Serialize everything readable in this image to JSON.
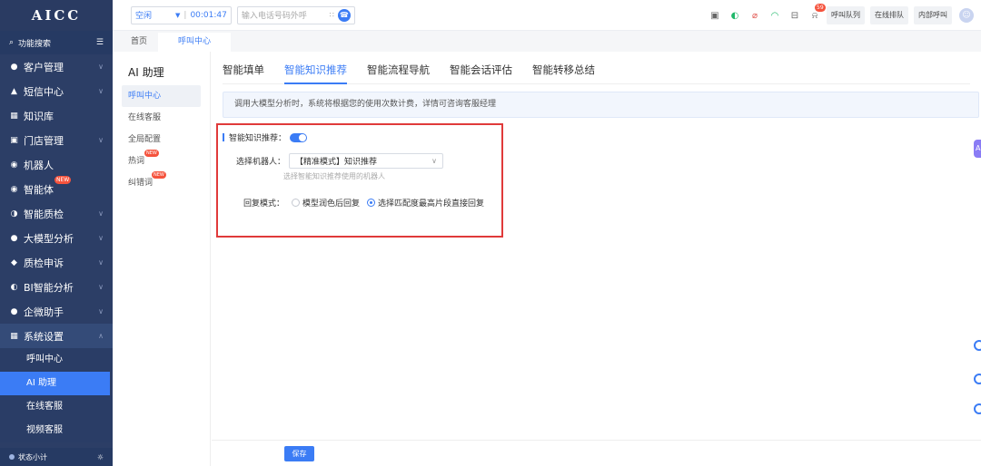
{
  "app": {
    "logo": "AICC"
  },
  "sidebar": {
    "search_label": "功能搜索",
    "items": [
      {
        "label": "客户管理",
        "icon": "users-icon"
      },
      {
        "label": "短信中心",
        "icon": "message-icon"
      },
      {
        "label": "知识库",
        "icon": "grid-icon"
      },
      {
        "label": "门店管理",
        "icon": "store-icon"
      },
      {
        "label": "机器人",
        "icon": "robot-icon"
      },
      {
        "label": "智能体",
        "icon": "agent-icon",
        "badge": "NEW"
      },
      {
        "label": "智能质检",
        "icon": "quality-icon"
      },
      {
        "label": "大模型分析",
        "icon": "model-icon"
      },
      {
        "label": "质检申诉",
        "icon": "shield-icon"
      },
      {
        "label": "BI智能分析",
        "icon": "chart-icon"
      },
      {
        "label": "企微助手",
        "icon": "wechat-icon"
      },
      {
        "label": "系统设置",
        "icon": "settings-icon"
      }
    ],
    "sub_items": [
      "呼叫中心",
      "AI 助理",
      "在线客服",
      "视频客服"
    ],
    "bottom_label": "状态小计"
  },
  "topbar": {
    "status": "空闲",
    "timer": "00:01:47",
    "phone_placeholder": "输入电话号码外呼",
    "notification_count": "59",
    "buttons": [
      "呼叫队列",
      "在线排队",
      "内部呼叫"
    ]
  },
  "page_tabs": [
    "首页",
    "呼叫中心"
  ],
  "subnav": {
    "title": "AI 助理",
    "items": [
      "呼叫中心",
      "在线客服",
      "全局配置",
      "热词",
      "纠错词"
    ],
    "new_badge": "NEW"
  },
  "main": {
    "tabs": [
      "智能填单",
      "智能知识推荐",
      "智能流程导航",
      "智能会话评估",
      "智能转移总结"
    ],
    "notice": "调用大模型分析时，系统将根据您的使用次数计费，详情可咨询客服经理",
    "toggle_label": "智能知识推荐：",
    "toggle_on": true,
    "robot_label": "选择机器人：",
    "robot_value": "【精准模式】知识推荐",
    "robot_hint": "选择智能知识推荐使用的机器人",
    "mode_label": "回复模式：",
    "mode_options": [
      "模型润色后回复",
      "选择匹配度最高片段直接回复"
    ],
    "save": "保存"
  },
  "colors": {
    "accent": "#3b7cf5",
    "sidebar": "#2c3e66",
    "highlight_box": "#e03a3a"
  }
}
